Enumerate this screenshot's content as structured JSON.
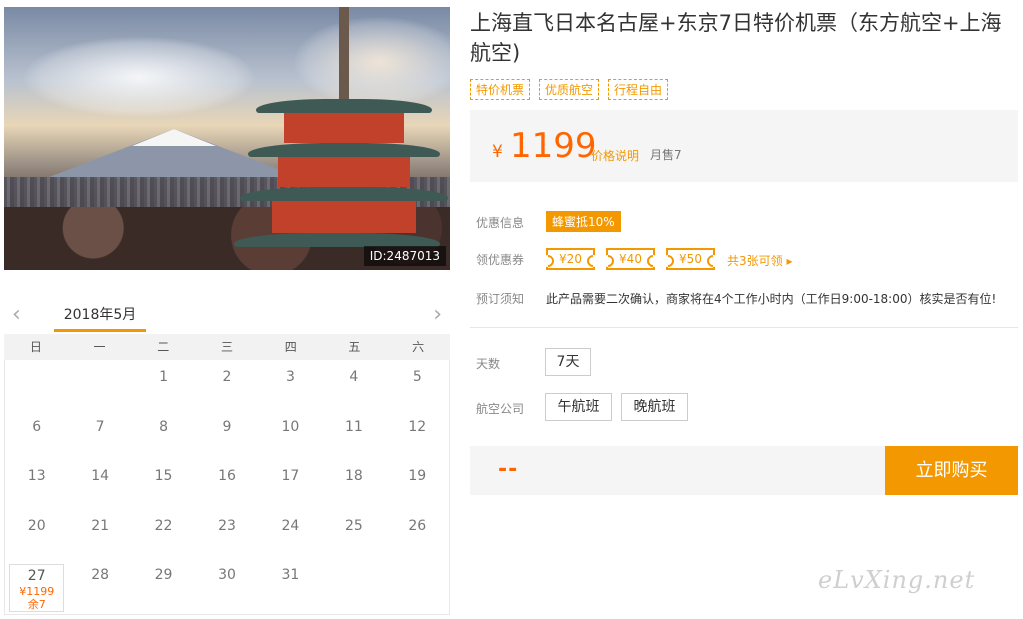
{
  "photo": {
    "id_label": "ID:2487013"
  },
  "calendar": {
    "month_label": "2018年5月",
    "prev_icon": "‹",
    "next_icon": "›",
    "weekdays": [
      "日",
      "一",
      "二",
      "三",
      "四",
      "五",
      "六"
    ],
    "weeks": [
      [
        "",
        "",
        "1",
        "2",
        "3",
        "4",
        "5"
      ],
      [
        "6",
        "7",
        "8",
        "9",
        "10",
        "11",
        "12"
      ],
      [
        "13",
        "14",
        "15",
        "16",
        "17",
        "18",
        "19"
      ],
      [
        "20",
        "21",
        "22",
        "23",
        "24",
        "25",
        "26"
      ],
      [
        "27",
        "28",
        "29",
        "30",
        "31",
        "",
        ""
      ]
    ],
    "active_day": {
      "day": "27",
      "price": "¥1199",
      "remain": "余7"
    }
  },
  "product": {
    "title": "上海直飞日本名古屋+东京7日特价机票（东方航空+上海航空)",
    "tags": [
      "特价机票",
      "优质航空",
      "行程自由"
    ],
    "price": {
      "yen": "¥",
      "value": "1199",
      "explain": "价格说明",
      "sold": "月售7"
    }
  },
  "info": {
    "discount_label": "优惠信息",
    "discount_value": "蜂蜜抵10%",
    "coupon_label": "领优惠券",
    "coupons": [
      "¥20",
      "¥40",
      "¥50"
    ],
    "coupon_link": "共3张可领 ▸",
    "notice_label": "预订须知",
    "notice_value": "此产品需要二次确认，商家将在4个工作小时内（工作日9:00-18:00）核实是否有位!"
  },
  "options": {
    "days_label": "天数",
    "days_value": "7天",
    "airline_label": "航空公司",
    "airline_options": [
      "午航班",
      "晚航班"
    ]
  },
  "buy": {
    "total": "--",
    "button_label": "立即购买"
  },
  "watermark": "eLvXing.net",
  "colors": {
    "accent": "#f39800",
    "price": "#ff6600"
  }
}
